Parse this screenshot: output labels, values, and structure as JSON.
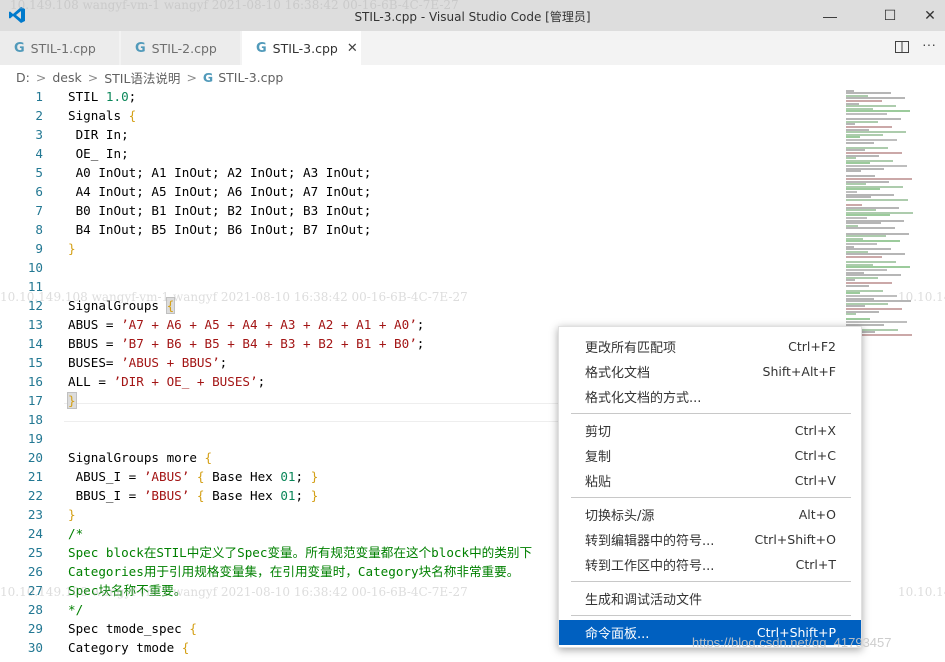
{
  "window": {
    "title": "STIL-3.cpp - Visual Studio Code [管理员]",
    "controls": {
      "minimize": "—",
      "maximize": "☐",
      "close": "✕"
    }
  },
  "tabs": [
    {
      "label": "STIL-1.cpp",
      "icon": "C++ file icon (G)",
      "active": false
    },
    {
      "label": "STIL-2.cpp",
      "icon": "C++ file icon (G)",
      "active": false
    },
    {
      "label": "STIL-3.cpp",
      "icon": "C++ file icon (G)",
      "active": true,
      "close": "✕"
    }
  ],
  "tab_icon_glyph": "G",
  "breadcrumb": {
    "items": [
      "D:",
      "desk",
      "STIL语法说明",
      "STIL-3.cpp"
    ],
    "separator": ">"
  },
  "editor": {
    "lines": [
      {
        "n": "1",
        "code": "STIL 1.0;"
      },
      {
        "n": "2",
        "code": "Signals {"
      },
      {
        "n": "3",
        "code": " DIR In;"
      },
      {
        "n": "4",
        "code": " OE_ In;"
      },
      {
        "n": "5",
        "code": " A0 InOut; A1 InOut; A2 InOut; A3 InOut;"
      },
      {
        "n": "6",
        "code": " A4 InOut; A5 InOut; A6 InOut; A7 InOut;"
      },
      {
        "n": "7",
        "code": " B0 InOut; B1 InOut; B2 InOut; B3 InOut;"
      },
      {
        "n": "8",
        "code": " B4 InOut; B5 InOut; B6 InOut; B7 InOut;"
      },
      {
        "n": "9",
        "code": "}"
      },
      {
        "n": "10",
        "code": ""
      },
      {
        "n": "11",
        "code": ""
      },
      {
        "n": "12",
        "code": "SignalGroups {"
      },
      {
        "n": "13",
        "code": "ABUS = ’A7 + A6 + A5 + A4 + A3 + A2 + A1 + A0’;"
      },
      {
        "n": "14",
        "code": "BBUS = ’B7 + B6 + B5 + B4 + B3 + B2 + B1 + B0’;"
      },
      {
        "n": "15",
        "code": "BUSES= ’ABUS + BBUS’;"
      },
      {
        "n": "16",
        "code": "ALL = ’DIR + OE_ + BUSES’;"
      },
      {
        "n": "17",
        "code": "}"
      },
      {
        "n": "18",
        "code": ""
      },
      {
        "n": "19",
        "code": ""
      },
      {
        "n": "20",
        "code": "SignalGroups more {"
      },
      {
        "n": "21",
        "code": " ABUS_I = ’ABUS’ { Base Hex 01; }"
      },
      {
        "n": "22",
        "code": " BBUS_I = ’BBUS’ { Base Hex 01; }"
      },
      {
        "n": "23",
        "code": "}"
      },
      {
        "n": "24",
        "code": "/*"
      },
      {
        "n": "25",
        "code": "Spec block在STIL中定义了Spec变量。所有规范变量都在这个block中的类别下"
      },
      {
        "n": "26",
        "code": "Categories用于引用规格变量集，在引用变量时，Category块名称非常重要。"
      },
      {
        "n": "27",
        "code": "Spec块名称不重要。"
      },
      {
        "n": "28",
        "code": "*/"
      },
      {
        "n": "29",
        "code": "Spec tmode_spec {"
      },
      {
        "n": "30",
        "code": "Category tmode {"
      }
    ]
  },
  "context_menu": {
    "groups": [
      [
        {
          "label": "更改所有匹配项",
          "shortcut": "Ctrl+F2"
        },
        {
          "label": "格式化文档",
          "shortcut": "Shift+Alt+F"
        },
        {
          "label": "格式化文档的方式...",
          "shortcut": ""
        }
      ],
      [
        {
          "label": "剪切",
          "shortcut": "Ctrl+X"
        },
        {
          "label": "复制",
          "shortcut": "Ctrl+C"
        },
        {
          "label": "粘贴",
          "shortcut": "Ctrl+V"
        }
      ],
      [
        {
          "label": "切换标头/源",
          "shortcut": "Alt+O"
        },
        {
          "label": "转到编辑器中的符号...",
          "shortcut": "Ctrl+Shift+O"
        },
        {
          "label": "转到工作区中的符号...",
          "shortcut": "Ctrl+T"
        }
      ],
      [
        {
          "label": "生成和调试活动文件",
          "shortcut": ""
        }
      ],
      [
        {
          "label": "命令面板...",
          "shortcut": "Ctrl+Shift+P",
          "selected": true
        }
      ]
    ]
  },
  "watermark": {
    "top": "10.149.108   wangyf-vm-1   wangyf   2021-08-10   16:38:42   00-16-6B-4C-7E-27",
    "mid": "10.10.149.108   wangyf-vm-1   wangyf   2021-08-10   16:38:42   00-16-6B-4C-7E-27",
    "right_partial": "10.10.14",
    "blog": "https://blog.csdn.net/qq_41793457"
  },
  "colors": {
    "accent": "#007acc",
    "selected_menu": "#0060c0",
    "line_number": "#237893",
    "number": "#098658",
    "string": "#a31515",
    "comment": "#008000",
    "brace": "#d4a017"
  }
}
